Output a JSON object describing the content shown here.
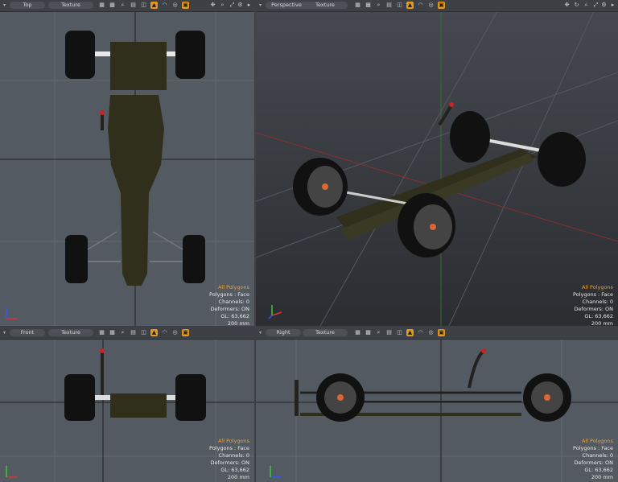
{
  "viewports": {
    "top": {
      "view_label": "Top",
      "shading_label": "Texture"
    },
    "perspective": {
      "view_label": "Perspective",
      "shading_label": "Texture"
    },
    "front": {
      "view_label": "Front",
      "shading_label": "Texture"
    },
    "right": {
      "view_label": "Right",
      "shading_label": "Texture"
    }
  },
  "stats": {
    "selection": "All Polygons",
    "polygons": "Polygons : Face",
    "channels": "Channels: 0",
    "deformers": "Deformers: ON",
    "gl": "GL: 63,662",
    "scale": "200 mm"
  },
  "colors": {
    "accent": "#e59a1d",
    "viewport_bg": "#545a61",
    "toolbar_bg": "#3d4044"
  },
  "icons": [
    "grid-icon",
    "wireframe-icon",
    "search-icon",
    "layers-icon",
    "texture-icon",
    "light-icon",
    "camera-icon",
    "settings-icon"
  ]
}
